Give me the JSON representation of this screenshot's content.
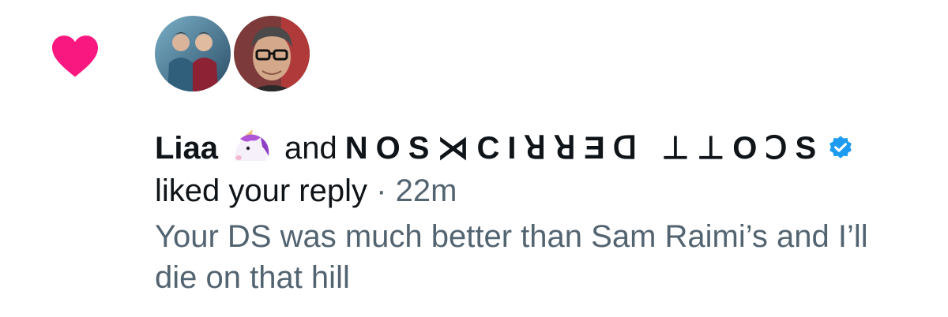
{
  "notification": {
    "user1_name": "Liaa",
    "connector": "and",
    "user2_name": "NOS⋊CIꓤꓤƎᗡ ⊥⊥OↃS",
    "action": "liked your reply",
    "separator": "·",
    "time": "22m",
    "reply_text": "Your DS was much better than Sam Raimi’s and I’ll die on that hill"
  },
  "icons": {
    "heart": "heart-icon",
    "unicorn": "unicorn-emoji",
    "verified": "verified-badge-icon"
  },
  "colors": {
    "heart": "#f91880",
    "verified": "#1d9bf0",
    "primary_text": "#0f1419",
    "secondary_text": "#536471"
  }
}
